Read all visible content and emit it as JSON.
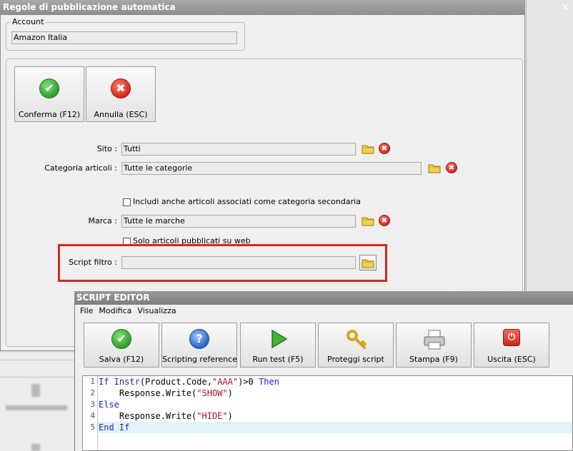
{
  "dialog": {
    "title": "Regole di pubblicazione automatica",
    "close": "×",
    "account": {
      "label": "Account",
      "value": "Amazon Italia"
    },
    "buttons": {
      "confirm": "Conferma (F12)",
      "cancel": "Annulla (ESC)"
    },
    "fields": {
      "site": {
        "label": "Sito :",
        "value": "Tutti"
      },
      "category": {
        "label": "Categoria articoli :",
        "value": "Tutte le categorie"
      },
      "include_secondary": {
        "label": "Includi anche articoli associati come categoria secondaria"
      },
      "brand": {
        "label": "Marca :",
        "value": "Tutte le marche"
      },
      "web_only": {
        "label": "Solo articoli pubblicati su web"
      },
      "script_filter": {
        "label": "Script filtro :",
        "value": ""
      }
    }
  },
  "editor": {
    "title": "SCRIPT EDITOR",
    "menu": [
      "File",
      "Modifica",
      "Visualizza"
    ],
    "toolbar": [
      {
        "icon": "save-check-icon",
        "label": "Salva (F12)"
      },
      {
        "icon": "help-icon",
        "label": "Scripting reference"
      },
      {
        "icon": "play-icon",
        "label": "Run test (F5)"
      },
      {
        "icon": "key-icon",
        "label": "Proteggi script"
      },
      {
        "icon": "printer-icon",
        "label": "Stampa (F9)"
      },
      {
        "icon": "exit-icon",
        "label": "Uscita (ESC)"
      }
    ],
    "code": {
      "line_numbers": [
        "1",
        "2",
        "3",
        "4",
        "5"
      ],
      "lines": [
        {
          "parts": [
            [
              "kw",
              "If"
            ],
            [
              "t",
              " "
            ],
            [
              "kw",
              "Instr"
            ],
            [
              "t",
              "(Product.Code,"
            ],
            [
              "str",
              "\"AAA\""
            ],
            [
              "t",
              ")>0 "
            ],
            [
              "kw",
              "Then"
            ]
          ]
        },
        {
          "parts": [
            [
              "t",
              "    Response.Write("
            ],
            [
              "str",
              "\"SHOW\""
            ],
            [
              "t",
              ")"
            ]
          ]
        },
        {
          "parts": [
            [
              "kw",
              "Else"
            ]
          ]
        },
        {
          "parts": [
            [
              "t",
              "    Response.Write("
            ],
            [
              "str",
              "\"HIDE\""
            ],
            [
              "t",
              ")"
            ]
          ]
        },
        {
          "parts": [
            [
              "kw",
              "End"
            ],
            [
              "t",
              " "
            ],
            [
              "kw",
              "If"
            ]
          ]
        }
      ]
    }
  },
  "colors": {
    "highlight": "#d8261e",
    "keyword": "#1a24c8",
    "string": "#b3122a",
    "confirm": "#2f9e2b",
    "cancel": "#d22a1a"
  }
}
